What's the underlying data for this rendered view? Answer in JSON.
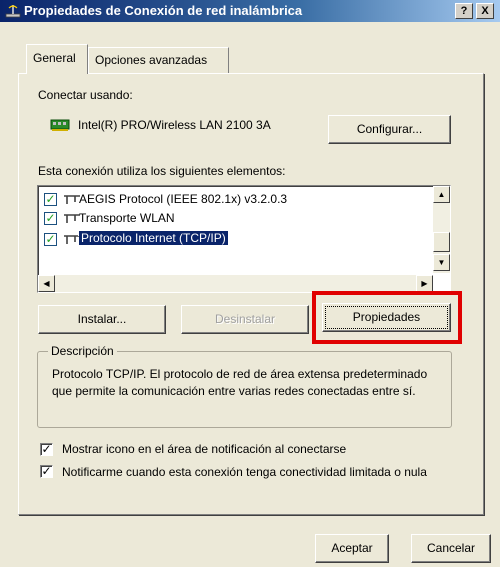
{
  "window": {
    "title": "Propiedades de Conexión de red inalámbrica",
    "help_label": "?",
    "close_label": "X"
  },
  "tabs": [
    {
      "label": "General",
      "active": true
    },
    {
      "label": "Opciones avanzadas",
      "active": false
    }
  ],
  "connect": {
    "label": "Conectar usando:",
    "adapter": "Intel(R) PRO/Wireless LAN 2100 3A",
    "configure_label": "Configurar..."
  },
  "components": {
    "label": "Esta conexión utiliza los siguientes elementos:",
    "items": [
      {
        "label": "AEGIS Protocol (IEEE 802.1x) v3.2.0.3",
        "checked": true,
        "selected": false
      },
      {
        "label": "Transporte WLAN",
        "checked": true,
        "selected": false
      },
      {
        "label": "Protocolo Internet (TCP/IP)",
        "checked": true,
        "selected": true
      }
    ]
  },
  "buttons": {
    "install": "Instalar...",
    "uninstall": "Desinstalar",
    "properties": "Propiedades",
    "ok": "Aceptar",
    "cancel": "Cancelar"
  },
  "description": {
    "legend": "Descripción",
    "text": "Protocolo TCP/IP. El protocolo de red de área extensa predeterminado que permite la comunicación entre varias redes conectadas entre sí."
  },
  "options": {
    "show_icon": {
      "label": "Mostrar icono en el área de notificación al conectarse",
      "checked": true
    },
    "notify_limited": {
      "label": "Notificarme cuando esta conexión tenga conectividad limitada o nula",
      "checked": true
    }
  },
  "colors": {
    "highlight": "#e00000",
    "selection": "#0a246a"
  }
}
